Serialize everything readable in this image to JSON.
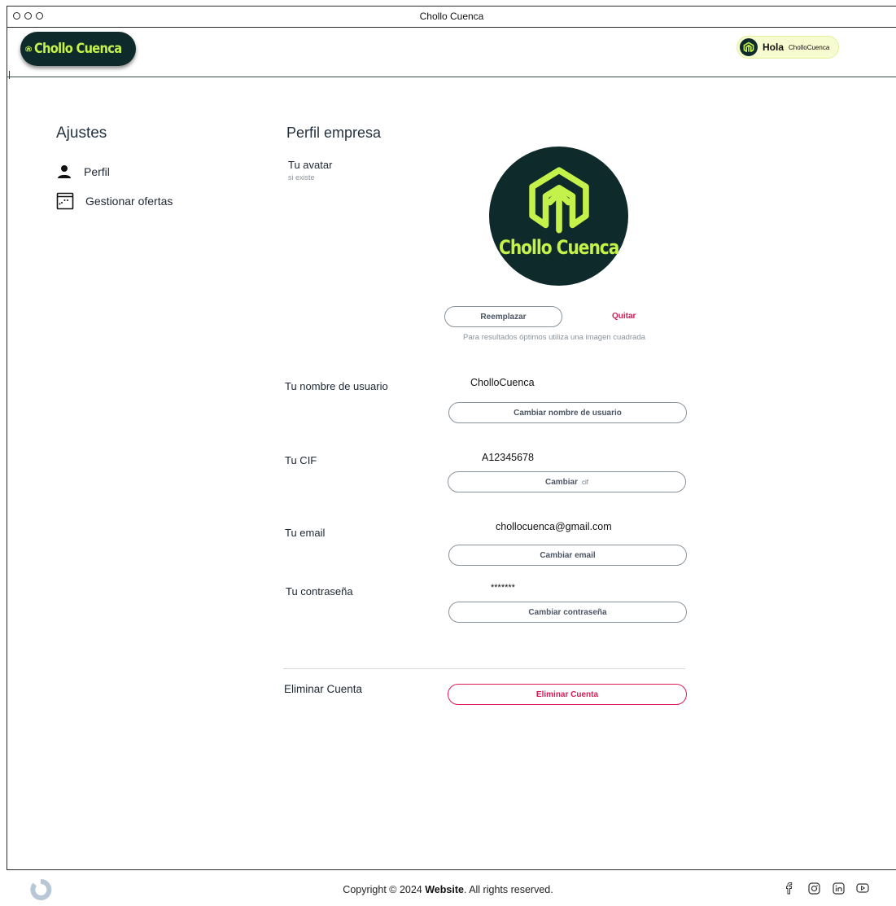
{
  "window": {
    "title": "Chollo Cuenca"
  },
  "navbar": {
    "brand": "Chollo Cuenca",
    "user_greeting": "Hola",
    "username": "CholloCuenca"
  },
  "sidebar": {
    "title": "Ajustes",
    "items": [
      {
        "label": "Perfil",
        "icon": "person-icon"
      },
      {
        "label": "Gestionar ofertas",
        "icon": "calendar-icon"
      }
    ]
  },
  "profile": {
    "title": "Perfil empresa",
    "avatar": {
      "label": "Tu avatar",
      "sublabel": "si existe",
      "brand": "Chollo Cuenca",
      "replace_label": "Reemplazar",
      "remove_label": "Quitar",
      "hint": "Para resultados óptimos utiliza una imagen cuadrada"
    },
    "username": {
      "label": "Tu nombre de usuario",
      "value": "CholloCuenca",
      "button": "Cambiar nombre de usuario"
    },
    "cif": {
      "label": "Tu CIF",
      "value": "A12345678",
      "button": "Cambiar",
      "button_suffix": "cif"
    },
    "email": {
      "label": "Tu email",
      "value": "chollocuenca@gmail.com",
      "button": "Cambiar email"
    },
    "password": {
      "label": "Tu contraseña",
      "value": "*******",
      "button": "Cambiar contraseña"
    },
    "delete": {
      "label": "Eliminar Cuenta",
      "button": "Eliminar Cuenta"
    }
  },
  "footer": {
    "copyright_prefix": "Copyright © 2024 ",
    "copyright_brand": "Website",
    "copyright_suffix": ". All rights reserved.",
    "socials": [
      "facebook-icon",
      "instagram-icon",
      "linkedin-icon",
      "youtube-icon"
    ]
  },
  "colors": {
    "brand_dark": "#0f2a2a",
    "brand_accent": "#c4f24b",
    "danger": "#d81b54"
  }
}
